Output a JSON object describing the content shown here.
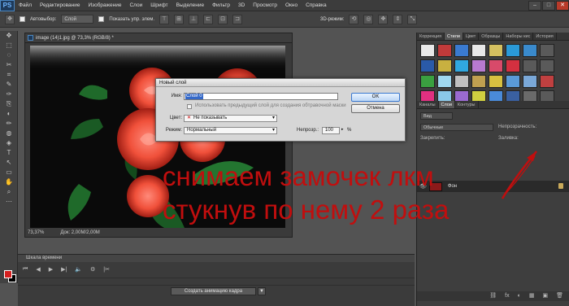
{
  "menubar": {
    "logo": "PS",
    "items": [
      "Файл",
      "Редактирование",
      "Изображение",
      "Слои",
      "Шрифт",
      "Выделение",
      "Фильтр",
      "3D",
      "Просмотр",
      "Окно",
      "Справка"
    ],
    "window_controls": [
      "–",
      "□",
      "✕"
    ]
  },
  "options": {
    "autoselect_label": "Автовыбор:",
    "autoselect_value": "Слой",
    "show_controls_label": "Показать упр. элем.",
    "mode_3d_label": "3D-режим:"
  },
  "toolbar": {
    "tools": [
      "✥",
      "⬚",
      "◌",
      "✂",
      "⌗",
      "✎",
      "✑",
      "⎘",
      "◐",
      "✏",
      "◍",
      "◈",
      "T",
      "↖",
      "▭",
      "✋",
      "⌕",
      "⋯"
    ]
  },
  "document": {
    "title": "image (14)1.jpg @ 73,3% (RGB/8) *",
    "zoom": "73,37%",
    "doc_info": "Док: 2,00M/2,00M"
  },
  "timeline": {
    "header": "Шкала времени",
    "controls": [
      "⏮",
      "◀",
      "▶",
      "▶|",
      "🔈",
      "⚙",
      "|✂"
    ],
    "create_button": "Создать анимацию кадра",
    "dropdown": "▼"
  },
  "styles_panel": {
    "tabs": [
      "Коррекция",
      "Стили",
      "Цвет",
      "Образцы",
      "Наборы кис",
      "История"
    ],
    "active_tab": "Стили",
    "swatches": [
      "#e8e8e8",
      "#c03a3a",
      "#3a7ad0",
      "#e8e8e8",
      "#d4c060",
      "#2a9ad8",
      "#3a8acc",
      "#5a5a5a",
      "#2a5aa8",
      "#c8b040",
      "#30a8e0",
      "#b87ad0",
      "#d84a6a",
      "#d43040",
      "#5a5a5a",
      "#5a5a5a",
      "#3aa040",
      "#a0d8f0",
      "#c0c0c0",
      "#c0a050",
      "#d8c040",
      "#5a9ad8",
      "#7aa8d8",
      "#c04040",
      "#e03080",
      "#8ac8e8",
      "#9a6ad0",
      "#d0d040",
      "#4a8ad8",
      "#3a60a0",
      "#6a6a6a",
      "#5a5a5a"
    ]
  },
  "layers_panel": {
    "tabs": [
      "Каналы",
      "Слои",
      "Контуры"
    ],
    "active_tab": "Слои",
    "kind_select": "Вид",
    "blend_mode": "Обычные",
    "opacity_label": "Непрозрачность:",
    "lock_label": "Закрепить:",
    "fill_label": "Заливка:",
    "layer_name": "Фон",
    "bottom_icons": [
      "⛓",
      "fx",
      "◐",
      "▦",
      "▣",
      "🗑"
    ]
  },
  "dialog": {
    "title": "Новый слой",
    "name_label": "Имя:",
    "name_value": "Слой 0",
    "checkbox_label": "Использовать предыдущий слой для создания обтравочной маски",
    "color_label": "Цвет:",
    "color_value": "Не показывать",
    "mode_label": "Режим:",
    "mode_value": "Нормальный",
    "opacity_label": "Непрозр.:",
    "opacity_value": "100",
    "opacity_unit": "%",
    "ok_label": "OK",
    "cancel_label": "Отмена"
  },
  "annotation": {
    "line1": "снимаем замочек лкм",
    "line2": "стукнув по нему 2 раза",
    "color": "#c10e0e"
  }
}
